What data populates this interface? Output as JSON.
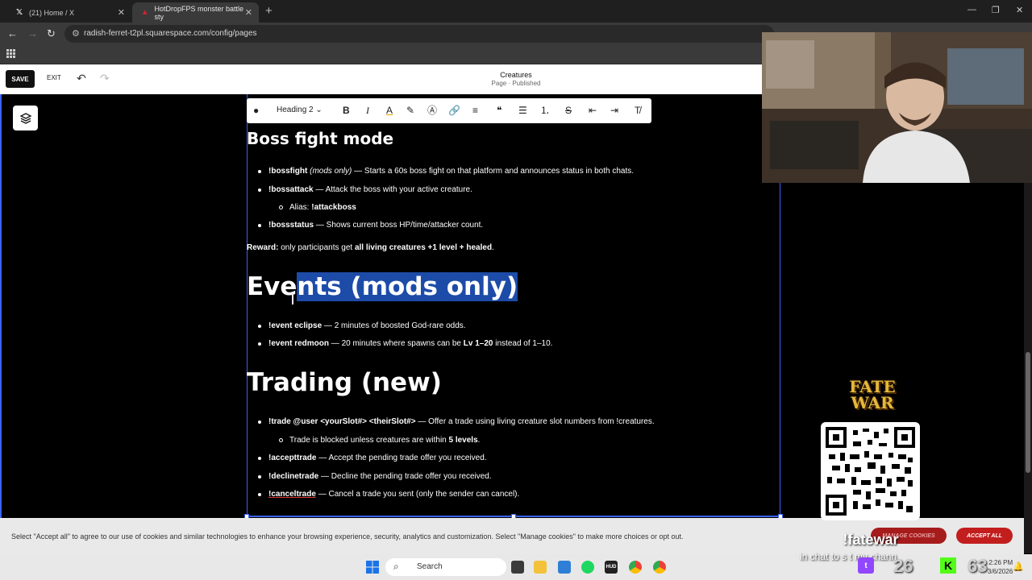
{
  "browser": {
    "tabs": [
      {
        "label": "(21) Home / X",
        "icon": "x-logo-icon"
      },
      {
        "label": "HotDropFPS monster battle sty",
        "icon": "squarespace-icon"
      }
    ],
    "url": "radish-ferret-t2pl.squarespace.com/config/pages"
  },
  "editor": {
    "save_label": "SAVE",
    "exit_label": "EXIT",
    "page_name": "Creatures",
    "page_status": "Page · Published",
    "toolbar": {
      "heading_style": "Heading 2"
    }
  },
  "content": {
    "boss_heading": "Boss fight mode",
    "boss_items": [
      {
        "cmd": "!bossfight",
        "note": "(mods only)",
        "text": " — Starts a 60s boss fight on that platform and announces status in both chats."
      },
      {
        "cmd": "!bossattack",
        "text": " — Attack the boss with your active creature."
      },
      {
        "alias_label": "Alias: ",
        "alias_cmd": "!attackboss"
      },
      {
        "cmd": "!bossstatus",
        "text": " — Shows current boss HP/time/attacker count."
      }
    ],
    "reward": {
      "label": "Reward:",
      "text1": " only participants get ",
      "bold": "all living creatures +1 level + healed",
      "text2": "."
    },
    "events_heading_pre": "Eve",
    "events_heading_sel": "nts (mods only)",
    "events_items": [
      {
        "cmd": "!event eclipse",
        "text": " — 2 minutes of boosted God-rare odds."
      },
      {
        "cmd": "!event redmoon",
        "text": " — 20 minutes where spawns can be ",
        "bold": "Lv 1–20",
        "text2": " instead of 1–10."
      }
    ],
    "trading_heading": "Trading (new)",
    "trading_items": [
      {
        "cmd": "!trade @user <yourSlot#> <theirSlot#>",
        "text": " — Offer a trade using living creature slot numbers from !creatures."
      },
      {
        "sub_text": "Trade is blocked unless creatures are within ",
        "sub_bold": "5 levels",
        "sub_end": "."
      },
      {
        "cmd": "!accepttrade",
        "text": " — Accept the pending trade offer you received."
      },
      {
        "cmd": "!declinetrade",
        "text": " — Decline the pending trade offer you received."
      },
      {
        "cmd": "!canceltrade",
        "text": " — Cancel a trade you sent (only the sender can cancel)."
      }
    ]
  },
  "cookie": {
    "text": "Select \"Accept all\" to agree to our use of cookies and similar technologies to enhance your browsing experience, security, analytics and customization. Select \"Manage cookies\" to make more choices or opt out.",
    "manage_label": "MANAGE COOKIES",
    "accept_label": "ACCEPT ALL"
  },
  "taskbar": {
    "search_label": "Search",
    "time": "2:26 PM",
    "date": "3/6/2026"
  },
  "stream_overlay": {
    "logo_line1": "FATE",
    "logo_line2": "WAR",
    "command": "!fatewar",
    "chat_line": "in chat to s     t my chann",
    "twitch_count": "26",
    "kick_count": "63"
  },
  "colors": {
    "selection": "#1d4ba8",
    "frame_accent": "#3b63f0",
    "accept_button": "#c21e1e"
  }
}
